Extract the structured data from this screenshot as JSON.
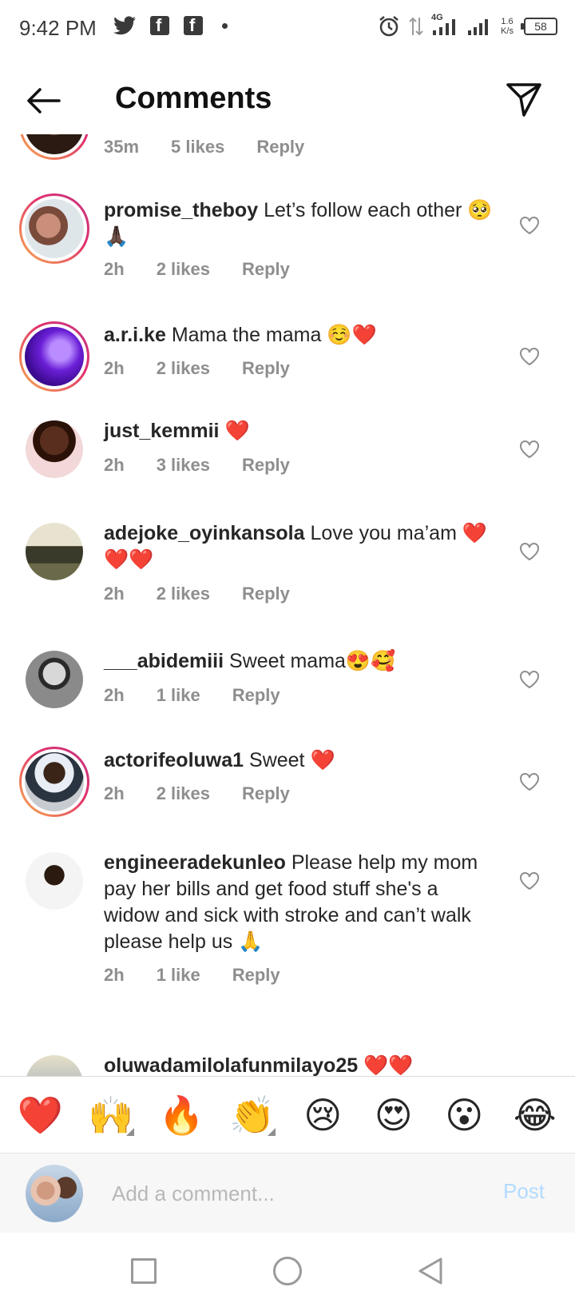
{
  "status_bar": {
    "time": "9:42 PM",
    "network": "4G",
    "speed_value": "1.6",
    "speed_unit": "K/s",
    "battery": "58",
    "left_icons": [
      "twitter-icon",
      "facebook-icon",
      "facebook-icon",
      "dot-icon"
    ],
    "right_icons": [
      "alarm-icon",
      "data-transfer-icon",
      "signal-icon",
      "signal-icon",
      "battery-icon"
    ]
  },
  "header": {
    "title": "Comments",
    "back_icon": "back-arrow-icon",
    "share_icon": "send-icon"
  },
  "comments": [
    {
      "username": "",
      "text": "",
      "time": "35m",
      "likes": "5 likes",
      "reply": "Reply",
      "partial": true,
      "ring": true
    },
    {
      "username": "promise_theboy",
      "text": "Let’s follow each other 🥺🙏🏿",
      "time": "2h",
      "likes": "2 likes",
      "reply": "Reply",
      "ring": true
    },
    {
      "username": "a.r.i.ke",
      "text": "Mama the mama ☺️❤️",
      "time": "2h",
      "likes": "2 likes",
      "reply": "Reply",
      "ring": true
    },
    {
      "username": "just_kemmii",
      "text": "❤️",
      "time": "2h",
      "likes": "3 likes",
      "reply": "Reply",
      "ring": false
    },
    {
      "username": "adejoke_oyinkansola",
      "text": "Love you ma’am ❤️❤️❤️",
      "time": "2h",
      "likes": "2 likes",
      "reply": "Reply",
      "ring": false
    },
    {
      "username": "___abidemiii",
      "text": "Sweet mama😍🥰",
      "time": "2h",
      "likes": "1 like",
      "reply": "Reply",
      "ring": false
    },
    {
      "username": "actorifeoluwa1",
      "text": "Sweet ❤️",
      "time": "2h",
      "likes": "2 likes",
      "reply": "Reply",
      "ring": true
    },
    {
      "username": "engineeradekunleo",
      "text": "Please help my mom pay her bills and get food stuff she's a widow and sick with stroke and can’t walk please help us 🙏",
      "time": "2h",
      "likes": "1 like",
      "reply": "Reply",
      "ring": false
    },
    {
      "username": "oluwadamilolafunmilayo25",
      "text": "❤️❤️",
      "time": "",
      "likes": "",
      "reply": "",
      "partial": true,
      "ring": false
    }
  ],
  "emoji_bar": [
    "❤️",
    "🙌",
    "🔥",
    "👏",
    "😢",
    "😍",
    "😮",
    "😂"
  ],
  "comment_input": {
    "placeholder": "Add a comment...",
    "post_label": "Post"
  },
  "colors": {
    "post_disabled": "#b3dbff",
    "meta_gray": "#8e8e8e",
    "heart_red": "#ed4956"
  }
}
